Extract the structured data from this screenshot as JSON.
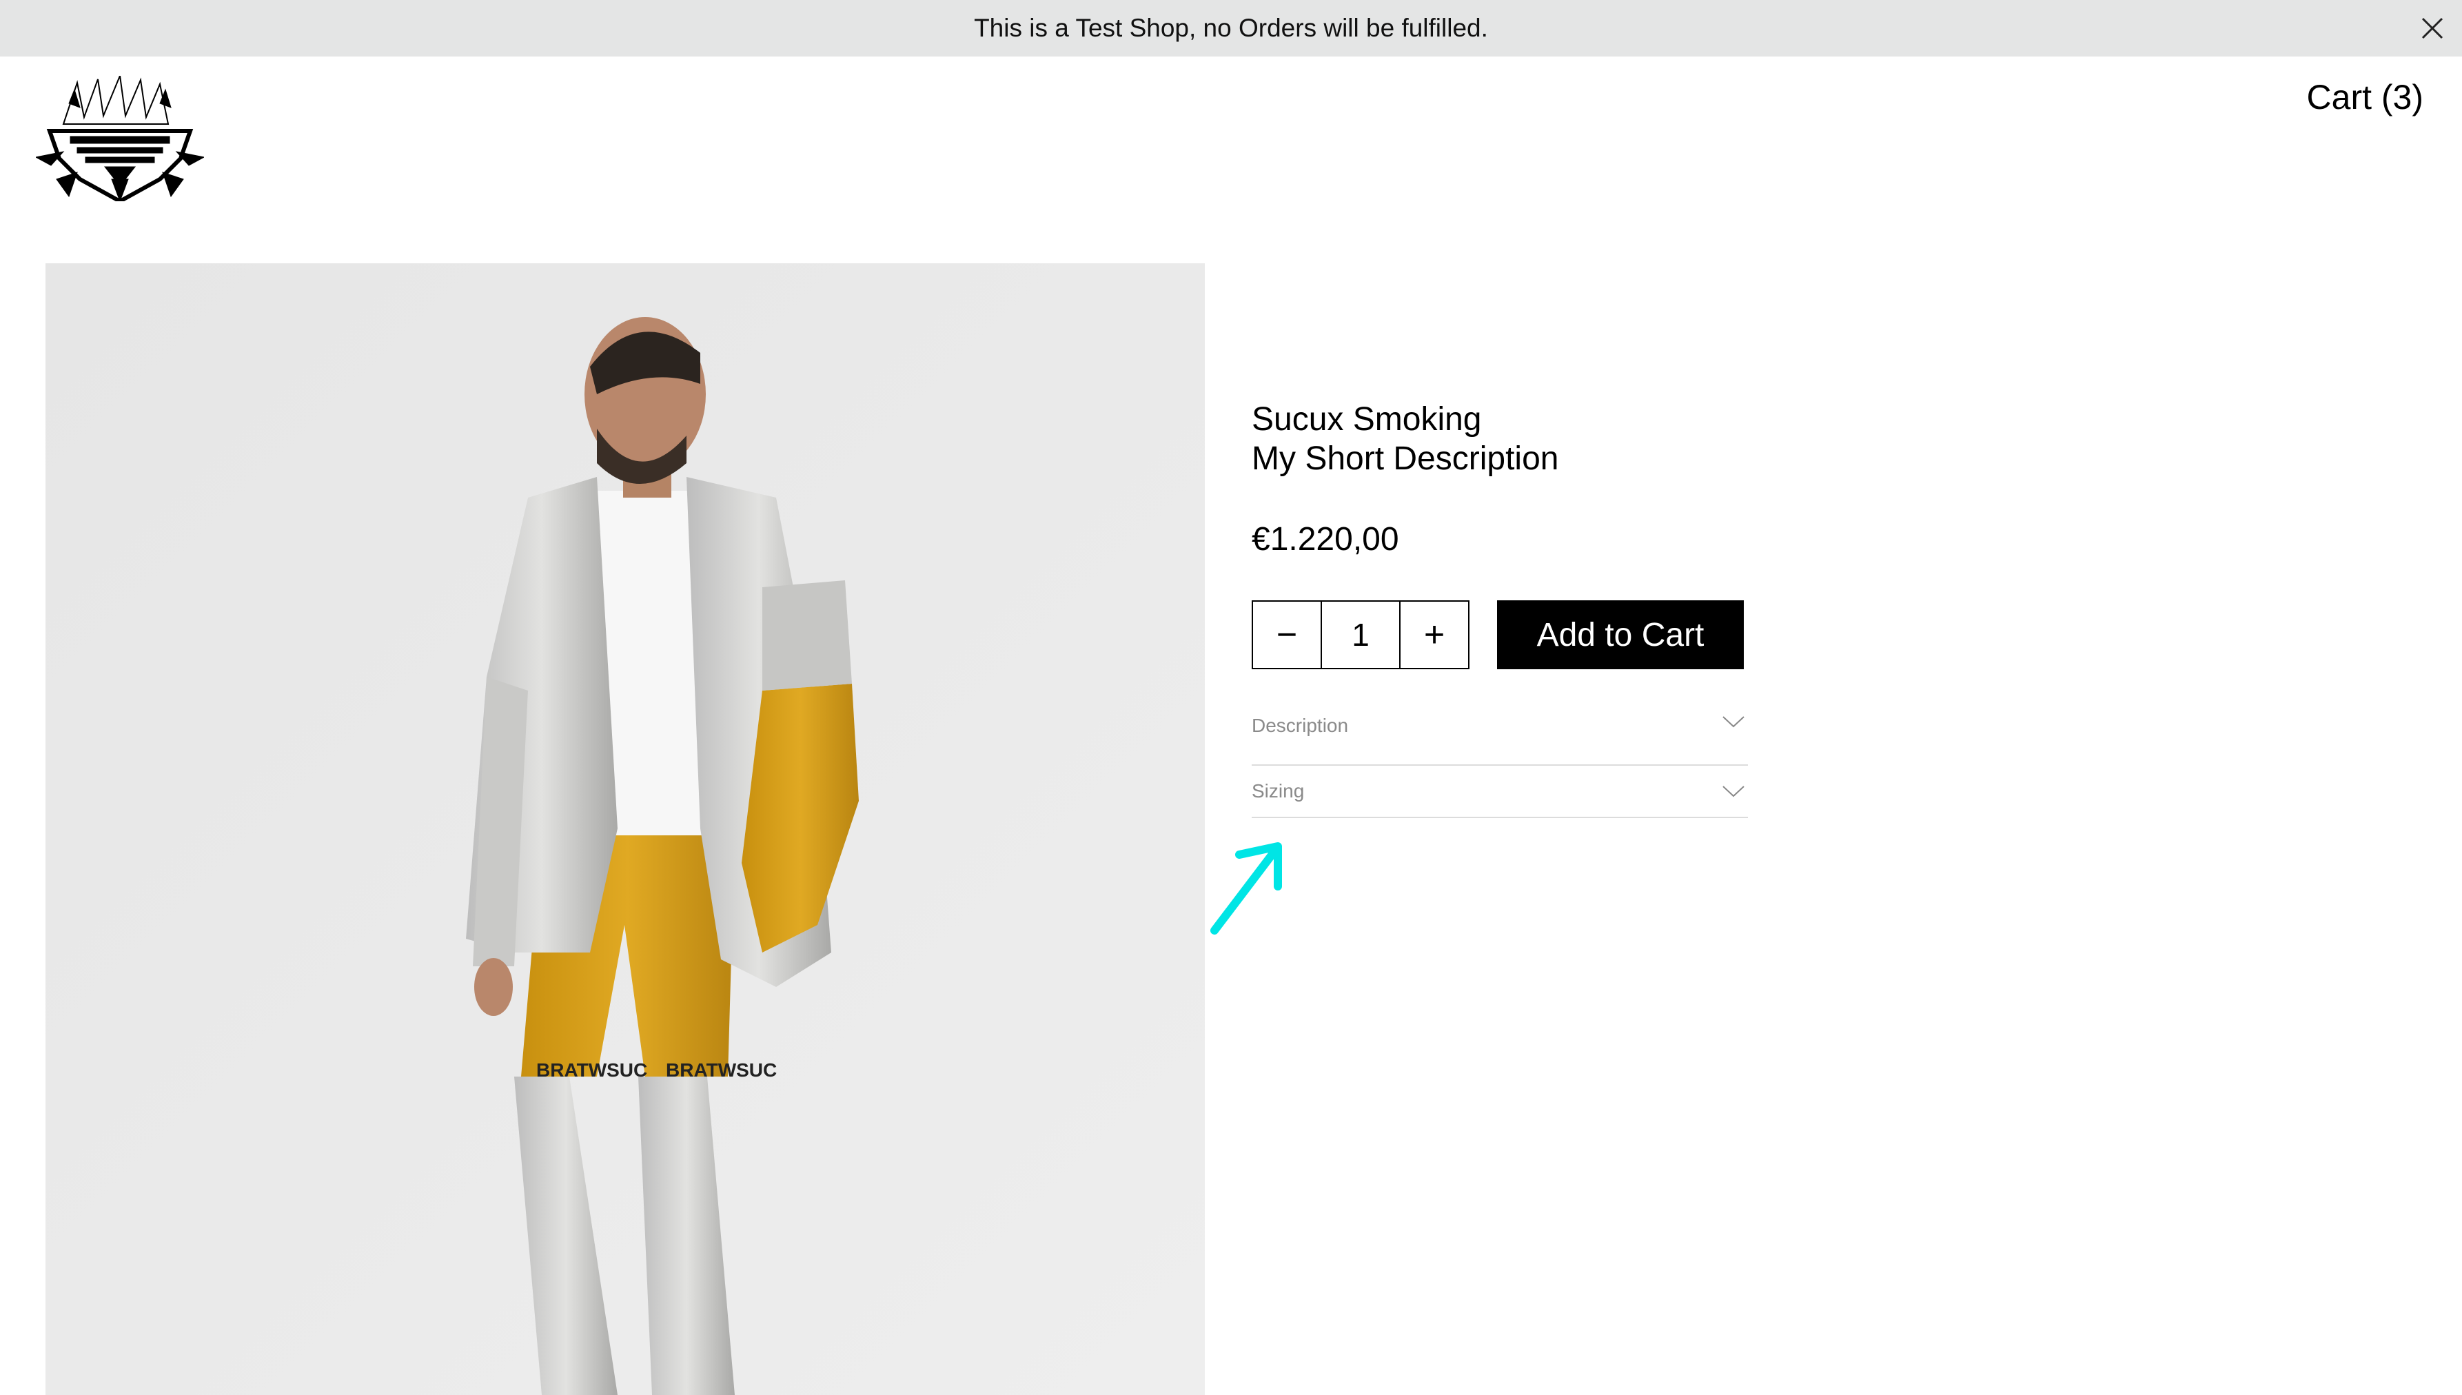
{
  "banner": {
    "message": "This is a Test Shop, no Orders will be fulfilled.",
    "close_icon": "close-icon"
  },
  "header": {
    "logo": "brand-logo",
    "cart_label": "Cart (3)"
  },
  "product": {
    "image": "product-photo-sucux-smoking",
    "title": "Sucux Smoking",
    "short_description": "My Short Description",
    "price": "€1.220,00",
    "quantity": {
      "minus_label": "−",
      "value": "1",
      "plus_label": "+"
    },
    "add_to_cart_label": "Add to Cart",
    "accordion": [
      {
        "label": "Description",
        "icon": "chevron-down-icon"
      },
      {
        "label": "Sizing",
        "icon": "chevron-down-icon"
      }
    ],
    "print_text": "BRATWSUC"
  },
  "annotation": {
    "arrow_color": "#00e5e5"
  },
  "colors": {
    "banner_bg": "#e4e5e5",
    "button_bg": "#000000",
    "mustard": "#d19a1a"
  }
}
